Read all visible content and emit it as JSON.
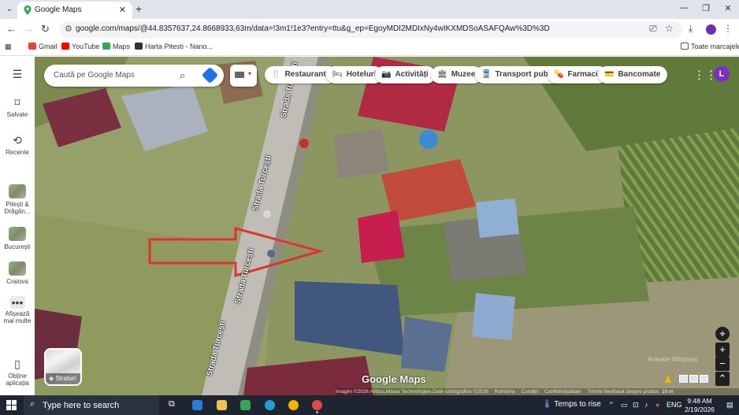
{
  "browser": {
    "tab_title": "Google Maps",
    "tab_close": "✕",
    "new_tab": "+",
    "url": "google.com/maps/@44.8357637,24.8668933,63m/data=!3m1!1e3?entry=ttu&g_ep=EgoyMDI2MDIxNy4wIKXMDSoASAFQAw%3D%3D",
    "window_controls": [
      "—",
      "❐",
      "✕"
    ],
    "profile_initial": "",
    "bookmarks": [
      {
        "label": "Gmail",
        "color": "#ea4335"
      },
      {
        "label": "YouTube",
        "color": "#ff0000"
      },
      {
        "label": "Maps",
        "color": "#34a853"
      },
      {
        "label": "Harta Pitesti - Nano...",
        "color": "#333333"
      }
    ],
    "all_bookmarks": "Toate marcajele"
  },
  "rail": {
    "menu_icon": "menu-icon",
    "saved": "Salvate",
    "recent": "Recente",
    "recent_places": [
      "Pitești & Drăgăn...",
      "București",
      "Craiova"
    ],
    "more": "Afișează mai multe",
    "get_app": "Obține aplicația"
  },
  "map": {
    "search_placeholder": "Caută pe Google Maps",
    "chips": [
      {
        "label": "Restaurante",
        "icon": "🍴"
      },
      {
        "label": "Hoteluri",
        "icon": "🛏"
      },
      {
        "label": "Activități",
        "icon": "📷"
      },
      {
        "label": "Muzee",
        "icon": "🏛"
      },
      {
        "label": "Transport public",
        "icon": "🚆"
      },
      {
        "label": "Farmacii",
        "icon": "💊"
      },
      {
        "label": "Bancomate",
        "icon": "💳"
      }
    ],
    "account_initial": "L",
    "layers_label": "Straturi",
    "street_label": "Strada Turcești",
    "logo": "Google Maps",
    "attribution": [
      "Imagini ©2026 Airbus,Maxar Technologies,Date cartografice ©2026",
      "România",
      "Condiții",
      "Confidențialitate",
      "Trimite feedback despre produs"
    ],
    "scale": "10 m",
    "watermark": "Activate Windows"
  },
  "taskbar": {
    "search_placeholder": "Type here to search",
    "weather": "Temps to rise",
    "language": "ENG",
    "time": "9:48 AM",
    "date": "2/19/2026"
  },
  "colors": {
    "accent": "#1a73e8",
    "arrow": "#e0342e",
    "taskbar": "#1f2530"
  }
}
